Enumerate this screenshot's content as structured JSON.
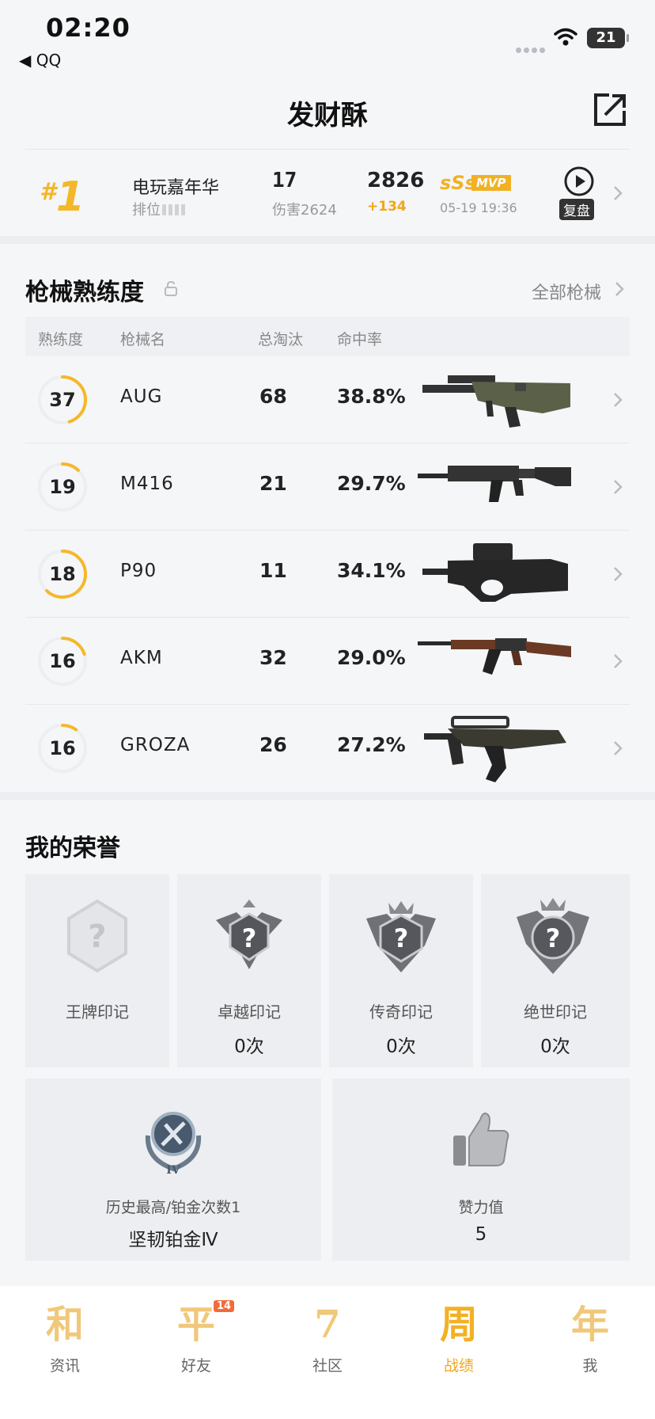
{
  "status_bar": {
    "time": "02:20",
    "back_app": "◀ QQ",
    "battery": "21"
  },
  "header": {
    "title": "发财酥"
  },
  "match": {
    "rank": "1",
    "mode": "电玩嘉年华",
    "mode_sub": "排位",
    "kills": "17",
    "damage": "伤害2624",
    "score": "2826",
    "score_delta": "+134",
    "grade": "sSs",
    "mvp": "MVP",
    "time": "05-19 19:36",
    "replay": "复盘"
  },
  "weapons": {
    "title": "枪械熟练度",
    "all_link": "全部枪械",
    "headers": {
      "proficiency": "熟练度",
      "name": "枪械名",
      "kills": "总淘汰",
      "hit": "命中率"
    },
    "rows": [
      {
        "level": "37",
        "name": "AUG",
        "kills": "68",
        "hit": "38.8%",
        "progress": 0.45
      },
      {
        "level": "19",
        "name": "M416",
        "kills": "21",
        "hit": "29.7%",
        "progress": 0.12
      },
      {
        "level": "18",
        "name": "P90",
        "kills": "11",
        "hit": "34.1%",
        "progress": 0.62
      },
      {
        "level": "16",
        "name": "AKM",
        "kills": "32",
        "hit": "29.0%",
        "progress": 0.2
      },
      {
        "level": "16",
        "name": "GROZA",
        "kills": "26",
        "hit": "27.2%",
        "progress": 0.1
      }
    ]
  },
  "honors": {
    "title": "我的荣誉",
    "cards": [
      {
        "name": "王牌印记",
        "count": ""
      },
      {
        "name": "卓越印记",
        "count": "0次"
      },
      {
        "name": "传奇印记",
        "count": "0次"
      },
      {
        "name": "绝世印记",
        "count": "0次"
      }
    ],
    "tier": {
      "label": "历史最高/铂金次数1",
      "value": "坚韧铂金Ⅳ"
    },
    "likes": {
      "label": "赞力值",
      "value": "5"
    }
  },
  "tabs": [
    {
      "glyph": "和",
      "label": "资讯"
    },
    {
      "glyph": "平",
      "label": "好友",
      "badge": "14"
    },
    {
      "glyph": "7",
      "label": "社区"
    },
    {
      "glyph": "周",
      "label": "战绩"
    },
    {
      "glyph": "年",
      "label": "我"
    }
  ],
  "colors": {
    "accent": "#f2b124",
    "ring_track": "#eceef1",
    "ring_fill": "#f5b829"
  },
  "icons": [
    "wifi-icon",
    "share-icon",
    "replay-icon",
    "lock-icon",
    "chevron-right-icon",
    "help-badge-icon",
    "thumbs-up-icon"
  ]
}
